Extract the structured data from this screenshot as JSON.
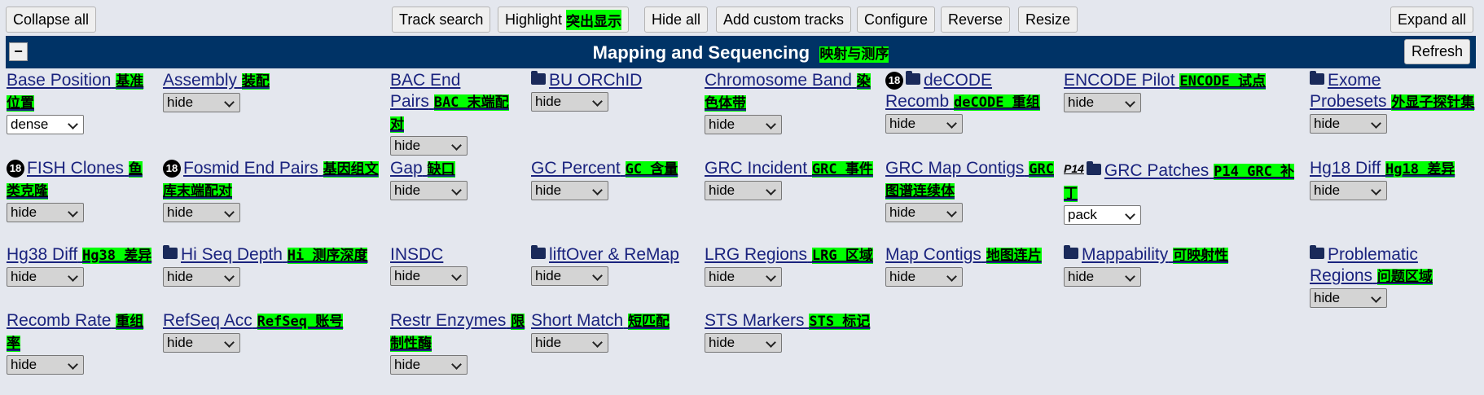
{
  "toolbar": {
    "collapse_all": "Collapse all",
    "track_search": "Track search",
    "highlight": "Highlight",
    "highlight_cn": "突出显示",
    "hide_all": "Hide all",
    "add_custom_tracks": "Add custom tracks",
    "configure": "Configure",
    "reverse": "Reverse",
    "resize": "Resize",
    "expand_all": "Expand all"
  },
  "group": {
    "toggle": "−",
    "title": "Mapping and Sequencing",
    "title_cn": "映射与测序",
    "refresh": "Refresh"
  },
  "badge18": "18",
  "p14_badge": "P14",
  "tracks": {
    "base_position": {
      "label": "Base Position",
      "cn": "基准位置",
      "value": "dense"
    },
    "assembly": {
      "label": "Assembly",
      "cn": "装配",
      "value": "hide"
    },
    "bac_end_pairs": {
      "label": "BAC End Pairs",
      "cn": "BAC 末端配对",
      "value": "hide"
    },
    "bu_orchid": {
      "label": "BU ORChID",
      "cn": "",
      "value": "hide"
    },
    "chromosome_band": {
      "label": "Chromosome Band",
      "cn": "染色体带",
      "value": "hide"
    },
    "decode_recomb": {
      "label": "deCODE Recomb",
      "cn": "deCODE 重组",
      "value": "hide"
    },
    "encode_pilot": {
      "label": "ENCODE Pilot",
      "cn": "ENCODE 试点",
      "value": "hide"
    },
    "exome_probesets": {
      "label": "Exome Probesets",
      "cn": "外显子探针集",
      "value": "hide"
    },
    "fish_clones": {
      "label": "FISH Clones",
      "cn": "鱼类克隆",
      "value": "hide"
    },
    "fosmid_end_pairs": {
      "label": "Fosmid End Pairs",
      "cn": "基因组文库末端配对",
      "value": "hide"
    },
    "gap": {
      "label": "Gap",
      "cn": "缺口",
      "value": "hide"
    },
    "gc_percent": {
      "label": "GC Percent",
      "cn": "GC 含量",
      "value": "hide"
    },
    "grc_incident": {
      "label": "GRC Incident",
      "cn": "GRC 事件",
      "value": "hide"
    },
    "grc_map_contigs": {
      "label": "GRC Map Contigs",
      "cn": "GRC 图谱连续体",
      "value": "hide"
    },
    "grc_patches": {
      "label": "GRC Patches",
      "cn": "P14 GRC 补丁",
      "value": "pack"
    },
    "hg18_diff": {
      "label": "Hg18 Diff",
      "cn": "Hg18 差异",
      "value": "hide"
    },
    "hg38_diff": {
      "label": "Hg38 Diff",
      "cn": "Hg38 差异",
      "value": "hide"
    },
    "hi_seq_depth": {
      "label": "Hi Seq Depth",
      "cn": "Hi 测序深度",
      "value": "hide"
    },
    "insdc": {
      "label": "INSDC",
      "cn": "",
      "value": "hide"
    },
    "liftover": {
      "label": "liftOver & ReMap",
      "cn": "",
      "value": "hide"
    },
    "lrg_regions": {
      "label": "LRG Regions",
      "cn": "LRG 区域",
      "value": "hide"
    },
    "map_contigs": {
      "label": "Map Contigs",
      "cn": "地图连片",
      "value": "hide"
    },
    "mappability": {
      "label": "Mappability",
      "cn": "可映射性",
      "value": "hide"
    },
    "problematic_regions": {
      "label": "Problematic Regions",
      "cn": "问题区域",
      "value": "hide"
    },
    "recomb_rate": {
      "label": "Recomb Rate",
      "cn": "重组率",
      "value": "hide"
    },
    "refseq_acc": {
      "label": "RefSeq Acc",
      "cn": "RefSeq 账号",
      "value": "hide"
    },
    "restr_enzymes": {
      "label": "Restr Enzymes",
      "cn": "限制性酶",
      "value": "hide"
    },
    "short_match": {
      "label": "Short Match",
      "cn": "短匹配",
      "value": "hide"
    },
    "sts_markers": {
      "label": "STS Markers",
      "cn": "STS 标记",
      "value": "hide"
    }
  }
}
